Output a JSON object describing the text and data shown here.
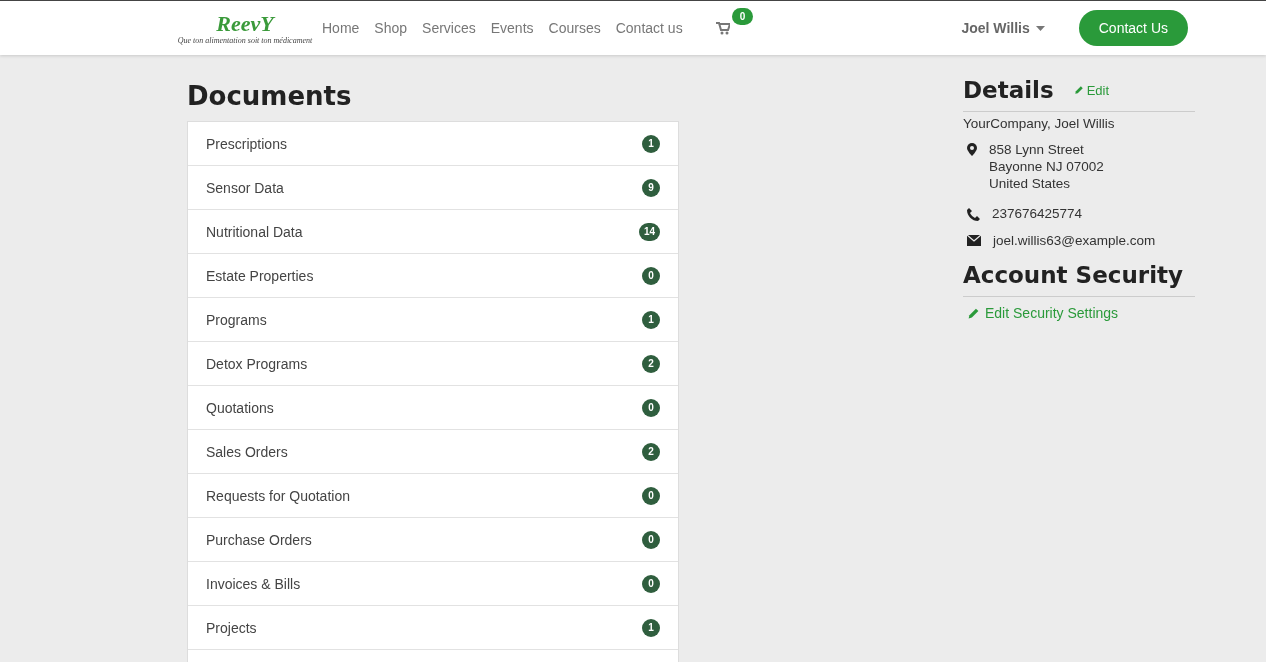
{
  "navbar": {
    "logo": {
      "text": "ReevY",
      "tagline": "Que ton alimentation soit ton médicament"
    },
    "menu": [
      {
        "label": "Home"
      },
      {
        "label": "Shop"
      },
      {
        "label": "Services"
      },
      {
        "label": "Events"
      },
      {
        "label": "Courses"
      },
      {
        "label": "Contact us"
      }
    ],
    "cart": {
      "count": "0"
    },
    "user": {
      "name": "Joel Willis"
    },
    "cta": "Contact Us"
  },
  "documents": {
    "title": "Documents",
    "items": [
      {
        "label": "Prescriptions",
        "count": "1"
      },
      {
        "label": "Sensor Data",
        "count": "9"
      },
      {
        "label": "Nutritional Data",
        "count": "14"
      },
      {
        "label": "Estate Properties",
        "count": "0"
      },
      {
        "label": "Programs",
        "count": "1"
      },
      {
        "label": "Detox Programs",
        "count": "2"
      },
      {
        "label": "Quotations",
        "count": "0"
      },
      {
        "label": "Sales Orders",
        "count": "2"
      },
      {
        "label": "Requests for Quotation",
        "count": "0"
      },
      {
        "label": "Purchase Orders",
        "count": "0"
      },
      {
        "label": "Invoices & Bills",
        "count": "0"
      },
      {
        "label": "Projects",
        "count": "1"
      }
    ]
  },
  "details": {
    "title": "Details",
    "edit": "Edit",
    "company": "YourCompany, Joel Willis",
    "address": [
      "858 Lynn Street",
      "Bayonne NJ 07002",
      "United States"
    ],
    "phone": "237676425774",
    "email": "joel.willis63@example.com"
  },
  "security": {
    "title": "Account Security",
    "link": "Edit Security Settings"
  }
}
